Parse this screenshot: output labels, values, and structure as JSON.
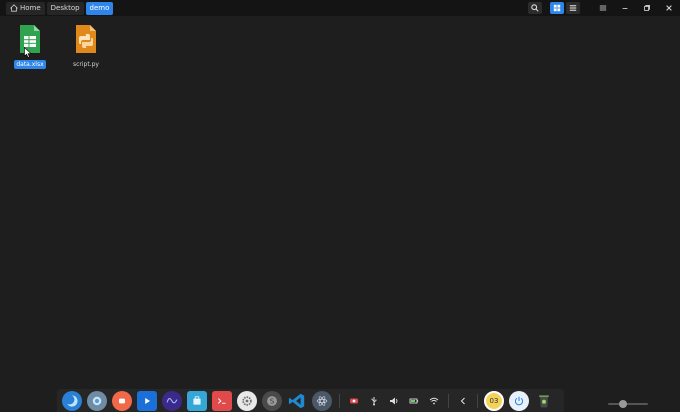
{
  "breadcrumb": {
    "items": [
      {
        "label": "Home",
        "icon": "home-icon"
      },
      {
        "label": "Desktop"
      },
      {
        "label": "demo"
      }
    ]
  },
  "toolbar": {
    "search_icon": "search-icon",
    "grid_view_icon": "grid-view-icon",
    "list_view_icon": "list-view-icon",
    "menu_icon": "hamburger-menu-icon",
    "minimize_icon": "minimize-icon",
    "restore_icon": "restore-icon",
    "close_icon": "close-icon"
  },
  "files": [
    {
      "name": "data.xlsx",
      "icon": "spreadsheet-file-icon",
      "color": "#2fa34f",
      "selected": true
    },
    {
      "name": "script.py",
      "icon": "python-file-icon",
      "color": "#e0891a",
      "selected": false
    }
  ],
  "dock": {
    "apps": [
      {
        "icon": "deepin-launcher-icon",
        "color": "#3aa0e8"
      },
      {
        "icon": "browser-icon",
        "color": "#5a9bd6"
      },
      {
        "icon": "screen-recorder-icon",
        "color": "#f06a4a"
      },
      {
        "icon": "video-player-icon",
        "color": "#1a6fd8"
      },
      {
        "icon": "system-monitor-icon",
        "color": "#5b3fc4"
      },
      {
        "icon": "app-store-icon",
        "color": "#34a7d6"
      },
      {
        "icon": "terminal-icon",
        "color": "#e04a4a"
      },
      {
        "icon": "settings-icon",
        "color": "#8a8a8a"
      },
      {
        "icon": "sublime-text-icon",
        "color": "#6d6d6d"
      },
      {
        "icon": "vscode-icon",
        "color": "#1f8ad2"
      },
      {
        "icon": "atom-icon",
        "color": "#4a5868"
      }
    ],
    "tray": [
      {
        "icon": "record-tray-icon",
        "color": "#e04a4a"
      },
      {
        "icon": "usb-tray-icon",
        "color": "#dddddd"
      },
      {
        "icon": "volume-tray-icon",
        "color": "#dddddd"
      },
      {
        "icon": "battery-tray-icon",
        "color": "#dddddd"
      },
      {
        "icon": "wifi-tray-icon",
        "color": "#dddddd"
      },
      {
        "icon": "collapse-tray-icon",
        "color": "#dddddd"
      }
    ],
    "clock_label": "03",
    "extra": [
      {
        "icon": "power-icon",
        "color": "#2f86ea"
      },
      {
        "icon": "trash-icon",
        "color": "#6aa84f"
      }
    ]
  }
}
